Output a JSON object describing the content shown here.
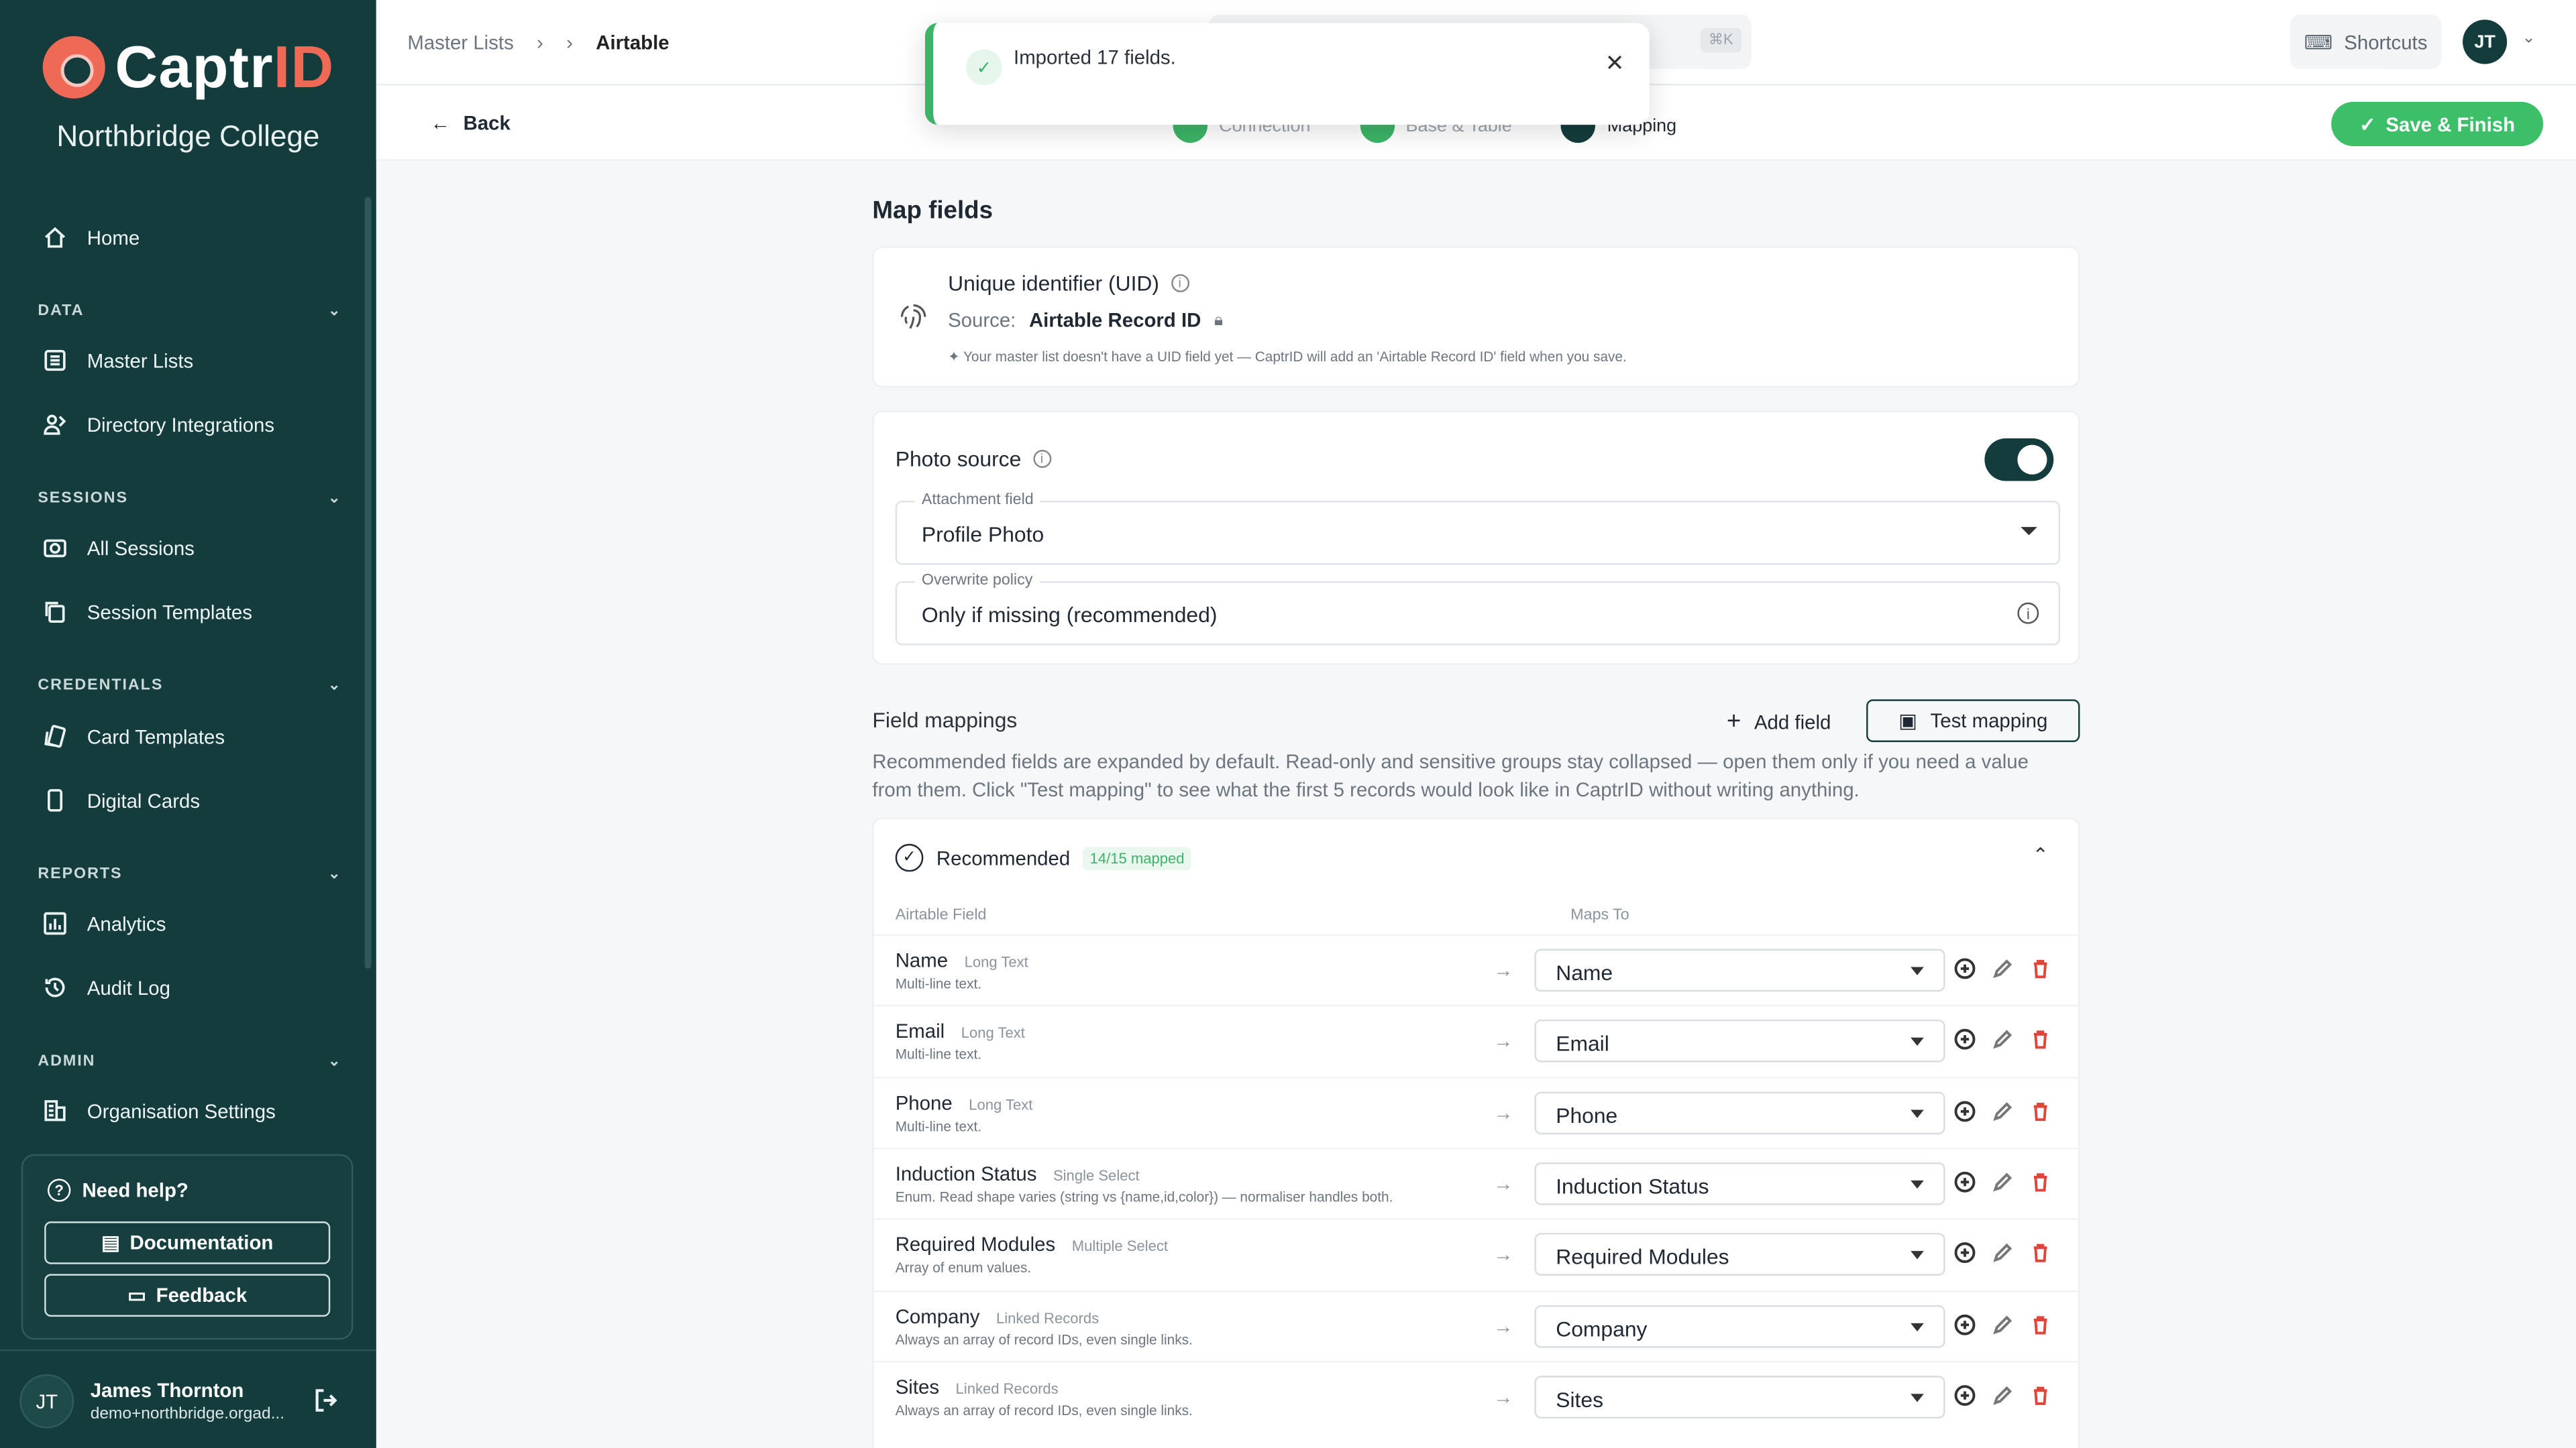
{
  "brand": {
    "name_prefix": "Captr",
    "name_suffix": "ID",
    "org": "Northbridge College"
  },
  "nav": {
    "home": "Home",
    "sections": [
      {
        "title": "DATA",
        "items": [
          "Master Lists",
          "Directory Integrations"
        ]
      },
      {
        "title": "SESSIONS",
        "items": [
          "All Sessions",
          "Session Templates"
        ]
      },
      {
        "title": "CREDENTIALS",
        "items": [
          "Card Templates",
          "Digital Cards"
        ]
      },
      {
        "title": "REPORTS",
        "items": [
          "Analytics",
          "Audit Log"
        ]
      },
      {
        "title": "ADMIN",
        "items": [
          "Organisation Settings"
        ]
      }
    ]
  },
  "help": {
    "title": "Need help?",
    "docs": "Documentation",
    "feedback": "Feedback"
  },
  "user": {
    "initials": "JT",
    "name": "James Thornton",
    "email": "demo+northbridge.orgad..."
  },
  "topbar": {
    "crumb_parent": "Master Lists",
    "crumb_current": "Airtable",
    "kbd": "⌘K",
    "shortcuts": "Shortcuts",
    "avatar": "JT"
  },
  "toast": {
    "message": "Imported 17 fields."
  },
  "subbar": {
    "back": "Back",
    "steps": [
      "Connection",
      "Base & Table",
      "Mapping"
    ],
    "save": "Save & Finish"
  },
  "map": {
    "title": "Map fields",
    "uid": {
      "title": "Unique identifier (UID)",
      "source_label": "Source:",
      "source_value": "Airtable Record ID",
      "note": "Your master list doesn't have a UID field yet — CaptrID will add an 'Airtable Record ID' field when you save."
    },
    "photo": {
      "title": "Photo source",
      "attachment_label": "Attachment field",
      "attachment_value": "Profile Photo",
      "overwrite_label": "Overwrite policy",
      "overwrite_value": "Only if missing (recommended)"
    },
    "mappings": {
      "title": "Field mappings",
      "add_field": "Add field",
      "test_mapping": "Test mapping",
      "description": "Recommended fields are expanded by default. Read-only and sensitive groups stay collapsed — open them only if you need a value from them. Click \"Test mapping\" to see what the first 5 records would look like in CaptrID without writing anything.",
      "group_title": "Recommended",
      "group_badge": "14/15 mapped",
      "col_source": "Airtable Field",
      "col_target": "Maps To",
      "rows": [
        {
          "name": "Name",
          "type": "Long Text",
          "desc": "Multi-line text.",
          "target": "Name"
        },
        {
          "name": "Email",
          "type": "Long Text",
          "desc": "Multi-line text.",
          "target": "Email"
        },
        {
          "name": "Phone",
          "type": "Long Text",
          "desc": "Multi-line text.",
          "target": "Phone"
        },
        {
          "name": "Induction Status",
          "type": "Single Select",
          "desc": "Enum. Read shape varies (string vs {name,id,color}) — normaliser handles both.",
          "target": "Induction Status"
        },
        {
          "name": "Required Modules",
          "type": "Multiple Select",
          "desc": "Array of enum values.",
          "target": "Required Modules"
        },
        {
          "name": "Company",
          "type": "Linked Records",
          "desc": "Always an array of record IDs, even single links.",
          "target": "Company"
        },
        {
          "name": "Sites",
          "type": "Linked Records",
          "desc": "Always an array of record IDs, even single links.",
          "target": "Sites"
        }
      ]
    }
  },
  "colors": {
    "sidebar": "#143c3c",
    "accent": "#3dbf6a",
    "brand": "#ee6a56"
  }
}
